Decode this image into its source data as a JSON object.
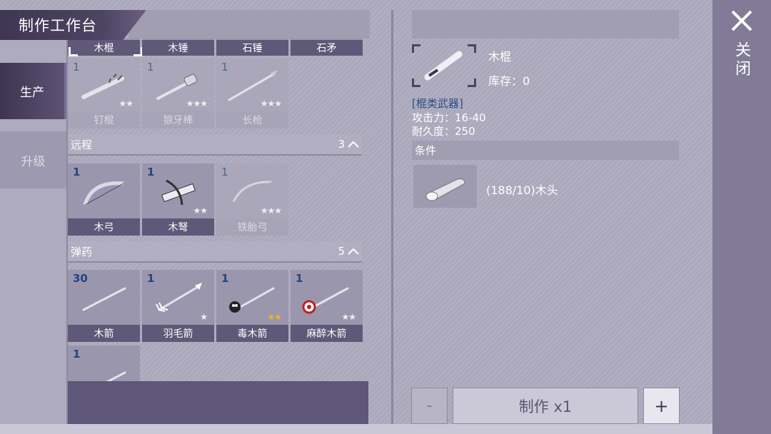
{
  "title": "制作工作台",
  "close_label": "关闭",
  "side_tabs": [
    {
      "label": "生产",
      "active": true
    },
    {
      "label": "升级",
      "active": false
    }
  ],
  "top_row": [
    "木棍",
    "木锤",
    "石锤",
    "石矛"
  ],
  "melee_row": [
    {
      "count": "1",
      "label": "钉棍",
      "stars": "★★",
      "star_color": "white",
      "enabled": false
    },
    {
      "count": "1",
      "label": "狼牙棒",
      "stars": "★★★",
      "star_color": "white",
      "enabled": false
    },
    {
      "count": "1",
      "label": "长枪",
      "stars": "★★★",
      "star_color": "white",
      "enabled": false
    }
  ],
  "sections": [
    {
      "name": "远程",
      "count": "3"
    },
    {
      "name": "弹药",
      "count": "5"
    }
  ],
  "ranged": [
    {
      "count": "1",
      "label": "木弓",
      "stars": "",
      "enabled": true
    },
    {
      "count": "1",
      "label": "木弩",
      "stars": "★★",
      "enabled": true
    },
    {
      "count": "1",
      "label": "铁胎弓",
      "stars": "★★★",
      "enabled": false
    }
  ],
  "ammo": [
    {
      "count": "30",
      "label": "木箭",
      "stars": "",
      "enabled": true
    },
    {
      "count": "1",
      "label": "羽毛箭",
      "stars": "★",
      "enabled": true
    },
    {
      "count": "1",
      "label": "毒木箭",
      "stars": "★★",
      "star_color": "gold",
      "enabled": true
    },
    {
      "count": "1",
      "label": "麻醉木箭",
      "stars": "★★",
      "enabled": true
    },
    {
      "count": "1",
      "label": "",
      "stars": "",
      "enabled": true
    }
  ],
  "detail": {
    "name": "木棍",
    "stock": "库存：0",
    "category": "[棍类武器]",
    "attack": "攻击力：16-40",
    "durability": "耐久度：250",
    "conditions_label": "条件",
    "material_text": "(188/10)木头"
  },
  "buttons": {
    "minus": "-",
    "make": "制作 x1",
    "plus": "+"
  }
}
